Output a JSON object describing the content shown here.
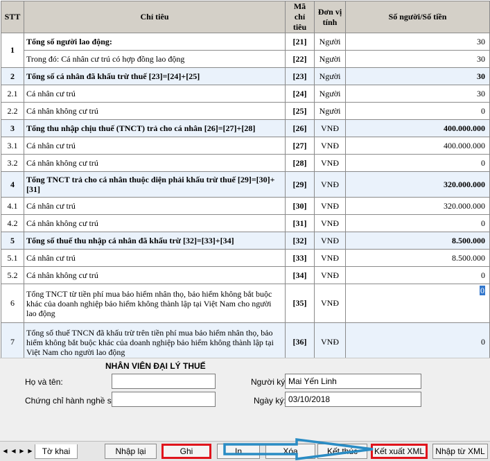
{
  "table": {
    "headers": {
      "stt": "STT",
      "chitieu": "Chỉ tiêu",
      "ma": "Mã chỉ tiêu",
      "dvt": "Đơn vị tính",
      "so": "Số người/Số tiền"
    },
    "r1": {
      "stt": "1",
      "a_desc": "Tổng số người lao động:",
      "a_code": "[21]",
      "a_unit": "Người",
      "a_val": "30",
      "b_desc": "Trong đó: Cá nhân cư trú có hợp đồng lao động",
      "b_code": "[22]",
      "b_unit": "Người",
      "b_val": "30"
    },
    "r2": {
      "stt": "2",
      "desc": "Tổng số cá nhân đã khấu trừ thuế [23]=[24]+[25]",
      "code": "[23]",
      "unit": "Người",
      "val": "30"
    },
    "r2_1": {
      "stt": "2.1",
      "desc": "Cá nhân cư trú",
      "code": "[24]",
      "unit": "Người",
      "val": "30"
    },
    "r2_2": {
      "stt": "2.2",
      "desc": "Cá nhân không cư trú",
      "code": "[25]",
      "unit": "Người",
      "val": "0"
    },
    "r3": {
      "stt": "3",
      "desc": "Tổng thu nhập chịu thuế (TNCT) trả cho cá nhân [26]=[27]+[28]",
      "code": "[26]",
      "unit": "VNĐ",
      "val": "400.000.000"
    },
    "r3_1": {
      "stt": "3.1",
      "desc": "Cá nhân cư trú",
      "code": "[27]",
      "unit": "VNĐ",
      "val": "400.000.000"
    },
    "r3_2": {
      "stt": "3.2",
      "desc": "Cá nhân không cư trú",
      "code": "[28]",
      "unit": "VNĐ",
      "val": "0"
    },
    "r4": {
      "stt": "4",
      "desc": "Tổng TNCT trả cho cá nhân thuộc diện phải khấu trừ thuế [29]=[30]+[31]",
      "code": "[29]",
      "unit": "VNĐ",
      "val": "320.000.000"
    },
    "r4_1": {
      "stt": "4.1",
      "desc": "Cá nhân cư trú",
      "code": "[30]",
      "unit": "VNĐ",
      "val": "320.000.000"
    },
    "r4_2": {
      "stt": "4.2",
      "desc": "Cá nhân không cư trú",
      "code": "[31]",
      "unit": "VNĐ",
      "val": "0"
    },
    "r5": {
      "stt": "5",
      "desc": "Tổng số thuế thu nhập cá nhân đã khấu trừ [32]=[33]+[34]",
      "code": "[32]",
      "unit": "VNĐ",
      "val": "8.500.000"
    },
    "r5_1": {
      "stt": "5.1",
      "desc": "Cá nhân cư trú",
      "code": "[33]",
      "unit": "VNĐ",
      "val": "8.500.000"
    },
    "r5_2": {
      "stt": "5.2",
      "desc": "Cá nhân không cư trú",
      "code": "[34]",
      "unit": "VNĐ",
      "val": "0"
    },
    "r6": {
      "stt": "6",
      "desc": "Tổng TNCT từ tiền phí mua bảo hiểm nhân thọ, bảo hiểm không bắt buộc khác của doanh nghiệp bảo hiểm không thành lập tại Việt Nam cho người lao động",
      "code": "[35]",
      "unit": "VNĐ",
      "val": "0"
    },
    "r7": {
      "stt": "7",
      "desc": "Tổng số thuế TNCN đã khấu trừ trên tiền phí mua bảo hiểm nhân thọ, bảo hiểm không bắt buộc khác của doanh nghiệp bảo hiểm không thành lập tại Việt Nam cho người lao động",
      "code": "[36]",
      "unit": "VNĐ",
      "val": "0"
    }
  },
  "agent": {
    "title": "NHÂN VIÊN ĐẠI LÝ THUẾ",
    "name_label": "Họ và tên:",
    "name_value": "",
    "cert_label": "Chứng chỉ hành nghề số:",
    "cert_value": "",
    "signer_label": "Người ký:",
    "signer_value": "Mai Yến Linh",
    "date_label": "Ngày ký:",
    "date_value": "03/10/2018"
  },
  "bottom": {
    "sheet_tab": "Tờ khai",
    "reset": "Nhập lại",
    "save": "Ghi",
    "print": "In",
    "delete": "Xóa",
    "close": "Kết thúc",
    "export_xml": "Kết xuất XML",
    "import_xml": "Nhập từ XML"
  },
  "colors": {
    "highlight_border": "#e0141c",
    "arrow": "#2a8cc4",
    "row_highlight": "#eaf2fb"
  }
}
